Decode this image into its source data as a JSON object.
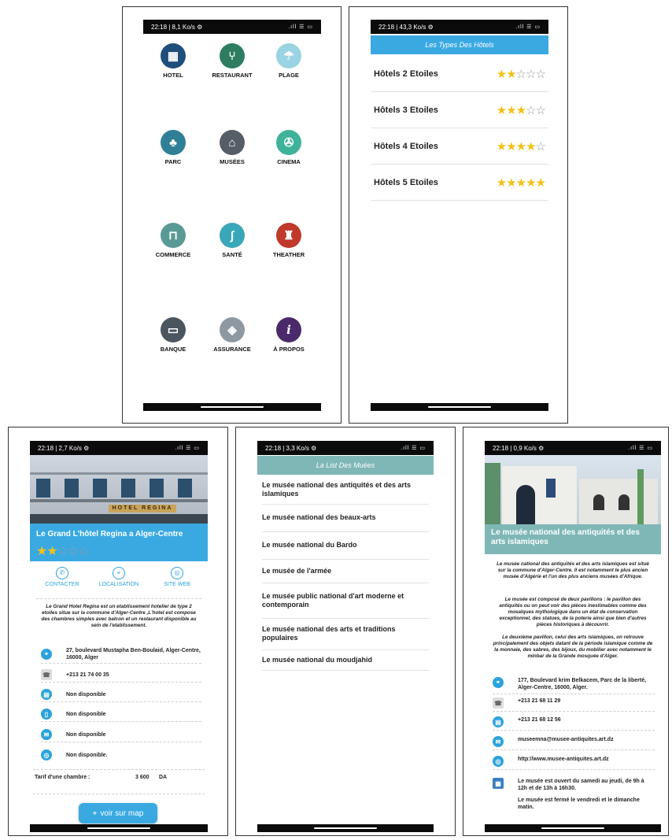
{
  "colors": {
    "accent_blue": "#3aa9e2",
    "accent_teal": "#7fb7b7",
    "star": "#f2c218",
    "status_bg": "#0b0b0b"
  },
  "screen1": {
    "status_left": "22:18 | 8,1 Ko/s ⚙",
    "status_right": ".ıll ☰ ▭",
    "items": [
      {
        "label": "HOTEL",
        "icon": "hotel-building-icon",
        "color": "#1e4e7a"
      },
      {
        "label": "RESTAURANT",
        "icon": "fork-knife-icon",
        "color": "#2e7d60"
      },
      {
        "label": "PLAGE",
        "icon": "beach-umbrella-icon",
        "color": "#9ad3e3"
      },
      {
        "label": "PARC",
        "icon": "tree-bench-icon",
        "color": "#2f7f96"
      },
      {
        "label": "MUSÉES",
        "icon": "museum-icon",
        "color": "#555d66"
      },
      {
        "label": "CINEMA",
        "icon": "film-reel-icon",
        "color": "#3fb39a"
      },
      {
        "label": "COMMERCE",
        "icon": "basket-icon",
        "color": "#5a9a96"
      },
      {
        "label": "SANTÉ",
        "icon": "stethoscope-icon",
        "color": "#3aa7b9"
      },
      {
        "label": "THEATHER",
        "icon": "theater-curtain-icon",
        "color": "#c0392b"
      },
      {
        "label": "BANQUE",
        "icon": "banknote-icon",
        "color": "#4b5560"
      },
      {
        "label": "ASSURANCE",
        "icon": "shield-icon",
        "color": "#8d98a3"
      },
      {
        "label": "À PROPOS",
        "icon": "info-icon",
        "color": "#4a2a6a"
      }
    ]
  },
  "screen2": {
    "status_left": "22:18 | 43,3 Ko/s ⚙",
    "status_right": ".ıll ☰ ▭",
    "header": "Les Types Des Hôtels",
    "rows": [
      {
        "label": "Hôtels 2 Etoiles",
        "stars": 2
      },
      {
        "label": "Hôtels 3 Etoiles",
        "stars": 3
      },
      {
        "label": "Hôtels 4 Etoiles",
        "stars": 4
      },
      {
        "label": "Hôtels 5 Etoiles",
        "stars": 5
      }
    ]
  },
  "screen3": {
    "status_left": "22:18 | 2,7 Ko/s ⚙",
    "status_right": ".ıll ☰ ▭",
    "sign_text": "HOTEL REGINA",
    "title": "Le Grand L'hôtel Regina a Alger-Centre",
    "stars": 2,
    "actions": [
      {
        "label": "CONTACTER",
        "icon": "phone-icon"
      },
      {
        "label": "LOCALISATION",
        "icon": "location-pin-icon"
      },
      {
        "label": "SITE WEB",
        "icon": "web-icon"
      }
    ],
    "description": "Le Grand Hotel Regina est un etablissement hotelier de type 2 etoiles situe sur la commune d'Alger-Centre ,L'hotel est compose des chambres simples avec balcon et un restaurant disponible au sein de l'etablissement.",
    "info": [
      {
        "icon": "location-pin-icon",
        "text": "27, boulevard Mustapha Ben-Boulaid, Alger-Centre, 16000, Alger"
      },
      {
        "icon": "telephone-icon",
        "text": "+213 21 74 00 35"
      },
      {
        "icon": "fax-icon",
        "text": "Non disponible"
      },
      {
        "icon": "mobile-icon",
        "text": "Non disponible"
      },
      {
        "icon": "email-icon",
        "text": "Non disponible"
      },
      {
        "icon": "web-icon",
        "text": "Non disponible."
      }
    ],
    "tarif_label": "Tarif d'une chambre :",
    "tarif_value": "3 600",
    "tarif_currency": "DA",
    "map_button": "voir sur map"
  },
  "screen4": {
    "status_left": "22:18 | 3,3 Ko/s ⚙",
    "status_right": ".ıll ☰ ▭",
    "header": "La List Des Muées",
    "rows": [
      "Le musée national des antiquités et des arts islamiques",
      "Le musée national des beaux-arts",
      "Le musée national du Bardo",
      "Le musée de l'armée",
      "Le musée public national d'art moderne et contemporain",
      "Le musée national des arts et traditions populaires",
      "Le musée national du moudjahid"
    ]
  },
  "screen5": {
    "status_left": "22:18 | 0,9 Ko/s ⚙",
    "status_right": ".ıll ☰ ▭",
    "title": "Le musée national des antiquités et des arts islamiques",
    "paragraphs": [
      "Le musée national des antiquités et des arts islamiques est situé sur la commune d'Alger-Centre. Il est notamment le plus ancien musée d'Algérie et l'un des plus anciens musées d'Afrique.",
      "Le musée est composé de deux pavillons : le pavillon des antiquités ou on peut voir des pièces inestimables comme des mosaïques mythologique dans un état de conservation exceptionnel, des statues, de la poterie ainsi que bien d'autres pièces historiques à découvrir.",
      "Le deuxième pavillon, celui des arts islamiques, on retrouve principalement des objets datant de la période islamique comme de la monnaie, des sabres, des bijoux, du mobilier avec notamment le minbar de la Grande mosquée d'Alger."
    ],
    "info": [
      {
        "icon": "location-pin-icon",
        "text": "177, Boulevard krim Belkacem, Parc de la liberté, Alger-Centre, 16000, Alger."
      },
      {
        "icon": "telephone-icon",
        "text": "+213 21 68 11 29"
      },
      {
        "icon": "fax-icon",
        "text": "+213 21 68 12 56"
      },
      {
        "icon": "email-icon",
        "text": "museemna@musee-antiquites.art.dz"
      },
      {
        "icon": "web-icon",
        "text": "http://www.musee-antiquites.art.dz"
      },
      {
        "icon": "calendar-icon",
        "text": "Le musée est ouvert du samedi au jeudi, de 9h à 12h et de 13h à 16h30.",
        "text2": "Le musée est fermé le vendredi et le dimanche matin."
      }
    ]
  }
}
